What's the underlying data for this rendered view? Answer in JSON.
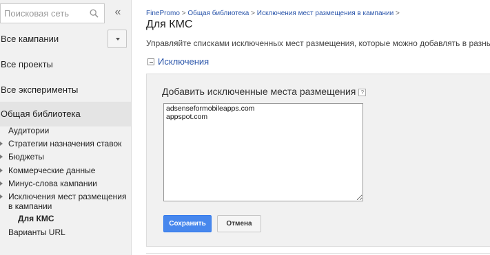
{
  "sidebar": {
    "search": {
      "placeholder": "Поисковая сеть",
      "value": ""
    },
    "collapse_glyph": "«",
    "nav": [
      {
        "label": "Все кампании"
      },
      {
        "label": "Все проекты"
      },
      {
        "label": "Все эксперименты"
      },
      {
        "label": "Общая библиотека",
        "selected": true
      }
    ],
    "library_items": [
      {
        "label": "Аудитории",
        "expandable": false
      },
      {
        "label": "Стратегии назначения ставок",
        "expandable": true
      },
      {
        "label": "Бюджеты",
        "expandable": true
      },
      {
        "label": "Коммерческие данные",
        "expandable": true
      },
      {
        "label": "Минус-слова кампании",
        "expandable": true
      },
      {
        "label": "Исключения мест размещения в кампании",
        "expandable": true
      },
      {
        "label": "Для КМС",
        "active": true
      },
      {
        "label": "Варианты URL",
        "expandable": false
      }
    ]
  },
  "breadcrumb": {
    "items": [
      "FinePromo",
      "Общая библиотека",
      "Исключения мест размещения в кампании"
    ],
    "separator": ">"
  },
  "page": {
    "title": "Для КМС",
    "description": "Управляйте списками исключенных мест размещения, которые можно добавлять в разные"
  },
  "section": {
    "toggle_label": "Исключения",
    "heading": "Добавить исключенные места размещения",
    "help_glyph": "?",
    "placements_value": "adsenseformobileapps.com\nappspot.com",
    "save_label": "Сохранить",
    "cancel_label": "Отмена"
  },
  "colors": {
    "link": "#2a55aa",
    "primary_button": "#4787ed",
    "sidebar_bg": "#f1f1f1",
    "selected_bg": "#e4e4e4"
  }
}
